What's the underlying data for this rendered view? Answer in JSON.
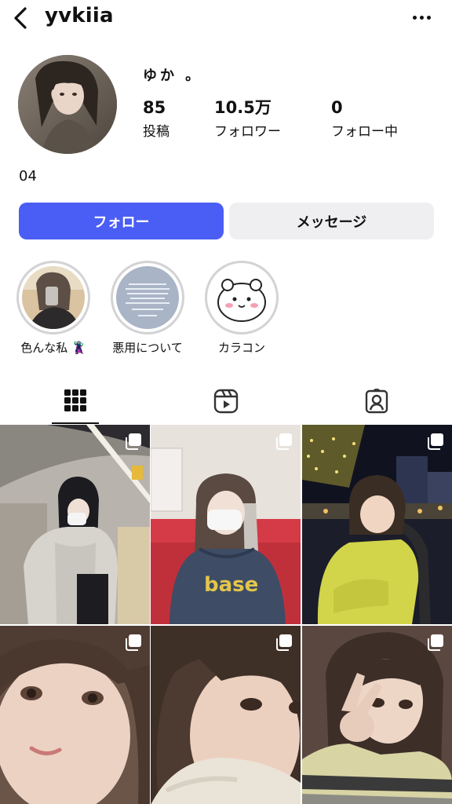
{
  "header": {
    "username": "yvkiia",
    "back_icon": "chevron-left-icon",
    "more_icon": "more-horizontal-icon"
  },
  "profile": {
    "display_name": "ゆか ｡",
    "stats": {
      "posts": {
        "value": "85",
        "label": "投稿"
      },
      "followers": {
        "value": "10.5万",
        "label": "フォロワー"
      },
      "following": {
        "value": "0",
        "label": "フォロー中"
      }
    },
    "bio": "04"
  },
  "actions": {
    "follow_label": "フォロー",
    "message_label": "メッセージ",
    "accent_color": "#4a5ef5"
  },
  "highlights": [
    {
      "label": "色んな私 🦹‍♂️"
    },
    {
      "label": "悪用について"
    },
    {
      "label": "カラコン"
    }
  ],
  "tabs": [
    {
      "icon": "grid-icon",
      "active": true
    },
    {
      "icon": "reels-icon",
      "active": false
    },
    {
      "icon": "tagged-icon",
      "active": false
    }
  ],
  "posts": [
    {
      "icon": "multiple-photos-icon"
    },
    {
      "icon": "multiple-photos-icon"
    },
    {
      "icon": "multiple-photos-icon"
    },
    {
      "icon": "multiple-photos-icon"
    },
    {
      "icon": "multiple-photos-icon"
    },
    {
      "icon": "multiple-photos-icon"
    }
  ]
}
